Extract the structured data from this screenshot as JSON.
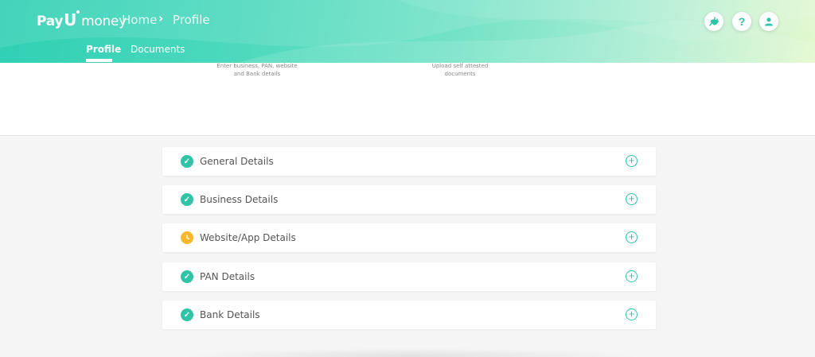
{
  "header": {
    "brand": {
      "pay": "Pay",
      "u": "U",
      "money": "money"
    },
    "breadcrumb": {
      "home": "Home",
      "separator": "›",
      "current": "Profile"
    },
    "tabs": [
      {
        "label": "Profile",
        "active": true
      },
      {
        "label": "Documents",
        "active": false
      }
    ],
    "icons": [
      "plug-icon",
      "help-icon",
      "user-icon"
    ],
    "help_glyph": "?"
  },
  "steps": {
    "left_text": "Enter business, PAN, website and Bank details",
    "right_text": "Upload self attested documents"
  },
  "accordion": {
    "items": [
      {
        "label": "General Details",
        "status": "complete"
      },
      {
        "label": "Business Details",
        "status": "complete"
      },
      {
        "label": "Website/App Details",
        "status": "pending"
      },
      {
        "label": "PAN Details",
        "status": "complete"
      },
      {
        "label": "Bank Details",
        "status": "complete"
      }
    ]
  },
  "colors": {
    "accent": "#2ec4a6",
    "pending": "#f6b72b",
    "header_start": "#2fd0b4",
    "header_end": "#e4f8cf"
  }
}
